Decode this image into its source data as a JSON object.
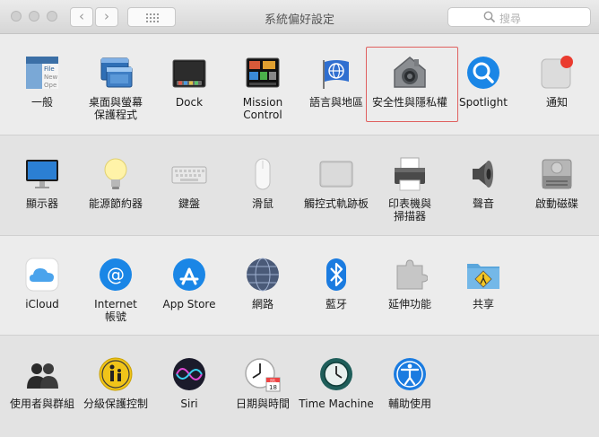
{
  "window": {
    "title": "系統偏好設定"
  },
  "search": {
    "placeholder": "搜尋"
  },
  "sections": [
    {
      "items": [
        {
          "label": "一般",
          "icon": "general-icon"
        },
        {
          "label": "桌面與螢幕\n保護程式",
          "icon": "desktop-screensaver-icon"
        },
        {
          "label": "Dock",
          "icon": "dock-icon"
        },
        {
          "label": "Mission\nControl",
          "icon": "mission-control-icon"
        },
        {
          "label": "語言與地區",
          "icon": "language-region-icon"
        },
        {
          "label": "安全性與隱私權",
          "icon": "security-privacy-icon"
        },
        {
          "label": "Spotlight",
          "icon": "spotlight-icon"
        },
        {
          "label": "通知",
          "icon": "notifications-icon"
        }
      ]
    },
    {
      "items": [
        {
          "label": "顯示器",
          "icon": "displays-icon"
        },
        {
          "label": "能源節約器",
          "icon": "energy-saver-icon"
        },
        {
          "label": "鍵盤",
          "icon": "keyboard-icon"
        },
        {
          "label": "滑鼠",
          "icon": "mouse-icon"
        },
        {
          "label": "觸控式軌跡板",
          "icon": "trackpad-icon"
        },
        {
          "label": "印表機與\n掃描器",
          "icon": "printers-scanners-icon"
        },
        {
          "label": "聲音",
          "icon": "sound-icon"
        },
        {
          "label": "啟動磁碟",
          "icon": "startup-disk-icon"
        }
      ]
    },
    {
      "items": [
        {
          "label": "iCloud",
          "icon": "icloud-icon"
        },
        {
          "label": "Internet\n帳號",
          "icon": "internet-accounts-icon"
        },
        {
          "label": "App Store",
          "icon": "app-store-icon"
        },
        {
          "label": "網路",
          "icon": "network-icon"
        },
        {
          "label": "藍牙",
          "icon": "bluetooth-icon"
        },
        {
          "label": "延伸功能",
          "icon": "extensions-icon"
        },
        {
          "label": "共享",
          "icon": "sharing-icon"
        }
      ]
    },
    {
      "items": [
        {
          "label": "使用者與群組",
          "icon": "users-groups-icon"
        },
        {
          "label": "分級保護控制",
          "icon": "parental-controls-icon"
        },
        {
          "label": "Siri",
          "icon": "siri-icon"
        },
        {
          "label": "日期與時間",
          "icon": "date-time-icon"
        },
        {
          "label": "Time Machine",
          "icon": "time-machine-icon"
        },
        {
          "label": "輔助使用",
          "icon": "accessibility-icon"
        }
      ]
    }
  ],
  "icon_text": {
    "general_file": "File",
    "general_new": "New",
    "general_open": "Ope",
    "calendar_month": "JUL",
    "calendar_day": "18"
  },
  "colors": {
    "selection_border": "#e0605f"
  },
  "selected_pane": "security-privacy"
}
